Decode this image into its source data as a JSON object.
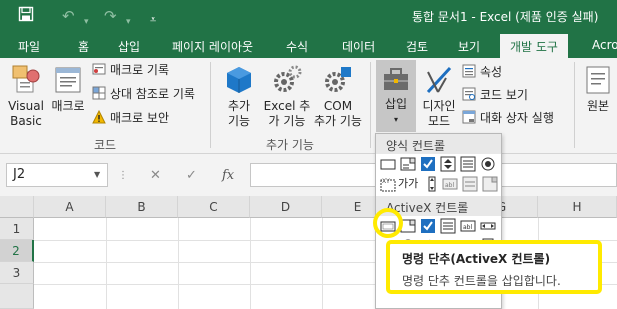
{
  "window": {
    "title": "통합 문서1 - Excel (제품 인증 실패)"
  },
  "quick_access": {
    "save_icon": "save-icon",
    "undo_icon": "undo-icon",
    "redo_icon": "redo-icon",
    "customize_icon": "customize-icon"
  },
  "tabs": [
    {
      "label": "파일"
    },
    {
      "label": "홈"
    },
    {
      "label": "삽입"
    },
    {
      "label": "페이지 레이아웃"
    },
    {
      "label": "수식"
    },
    {
      "label": "데이터"
    },
    {
      "label": "검토"
    },
    {
      "label": "보기"
    },
    {
      "label": "개발 도구",
      "active": true
    },
    {
      "label": "Acro"
    }
  ],
  "ribbon": {
    "code": {
      "visual_basic_line1": "Visual",
      "visual_basic_line2": "Basic",
      "macro": "매크로",
      "record_macro": "매크로 기록",
      "relative_reference": "상대 참조로 기록",
      "macro_security": "매크로 보안",
      "group_label": "코드"
    },
    "addins": {
      "addin_line1": "추가",
      "addin_line2": "기능",
      "excel_addin_line1": "Excel 추",
      "excel_addin_line2": "가 기능",
      "com_addin_line1": "COM",
      "com_addin_line2": "추가 기능",
      "group_label": "추가 기능"
    },
    "controls": {
      "insert": "삽입",
      "design_mode_line1": "디자인",
      "design_mode_line2": "모드",
      "properties": "속성",
      "view_code": "코드 보기",
      "run_dialog": "대화 상자 실행"
    },
    "xml": {
      "source": "원본"
    }
  },
  "formula_bar": {
    "name_box": "J2",
    "cancel_icon": "✕",
    "enter_icon": "✓",
    "fx": "fx"
  },
  "grid": {
    "columns": [
      "A",
      "B",
      "C",
      "D",
      "E",
      "F",
      "G",
      "H"
    ],
    "rows": [
      "1",
      "2",
      "3"
    ],
    "selected_row": "2"
  },
  "palette": {
    "form_controls_title": "양식 컨트롤",
    "activex_title": "ActiveX 컨트롤",
    "form_label_glyph": "가가",
    "activex_label_glyph": "가"
  },
  "tooltip": {
    "title": "명령 단추(ActiveX 컨트롤)",
    "description": "명령 단추 컨트롤을 삽입합니다."
  },
  "colors": {
    "excel_green": "#217346",
    "ribbon_bg": "#f3f3f3",
    "highlight": "#ffea00",
    "checkbox_blue": "#1e6fc0"
  }
}
